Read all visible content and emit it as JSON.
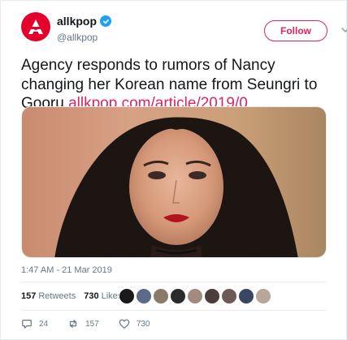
{
  "header": {
    "display_name": "allkpop",
    "handle": "@allkpop",
    "follow_label": "Follow"
  },
  "tweet": {
    "text": "Agency responds to rumors of Nancy changing her Korean name from Seungri to Gooru",
    "link": "allkpop.com/article/2019/0",
    "ellipsis": "…",
    "timestamp": "1:47 AM - 21 Mar 2019"
  },
  "stats": {
    "retweets_count": "157",
    "retweets_label": "Retweets",
    "likes_count": "730",
    "likes_label": "Likes"
  },
  "actions": {
    "replies": "24",
    "retweets": "157",
    "likes": "730"
  },
  "colors": {
    "brand_red": "#e4002b",
    "follow_pink": "#e0245e",
    "verified_blue": "#1da1f2",
    "muted_text": "#657786"
  },
  "icons": [
    "allkpop-logo-icon",
    "verified-badge-icon",
    "chevron-down-icon",
    "reply-icon",
    "retweet-icon",
    "like-icon"
  ]
}
